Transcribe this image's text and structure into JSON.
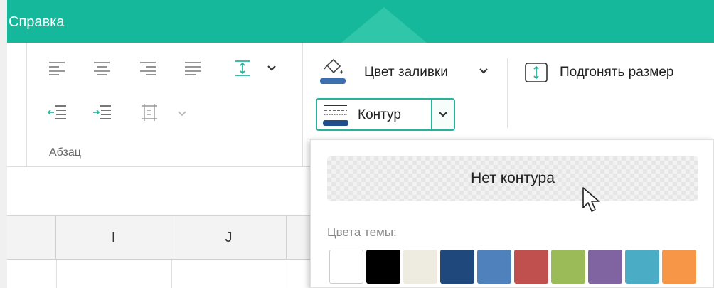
{
  "menu": {
    "help": "Справка"
  },
  "ribbon": {
    "paragraph_group_label": "Абзац",
    "fill": {
      "label": "Цвет заливки",
      "icon": "paint-bucket-icon"
    },
    "fit": {
      "label": "Подгонять размер",
      "icon": "fit-size-icon"
    },
    "contour": {
      "label": "Контур",
      "icon": "line-style-icon"
    }
  },
  "columns": [
    "I",
    "J"
  ],
  "dropdown": {
    "no_contour_label": "Нет контура",
    "theme_colors_label": "Цвета темы:",
    "swatches": [
      "#ffffff",
      "#000000",
      "#eeece1",
      "#1f497d",
      "#4f81bd",
      "#c0504d",
      "#9bbb59",
      "#8064a2",
      "#4bacc6",
      "#f79646"
    ]
  },
  "colors": {
    "accent": "#15b89a",
    "border_accent": "#26b39b"
  }
}
